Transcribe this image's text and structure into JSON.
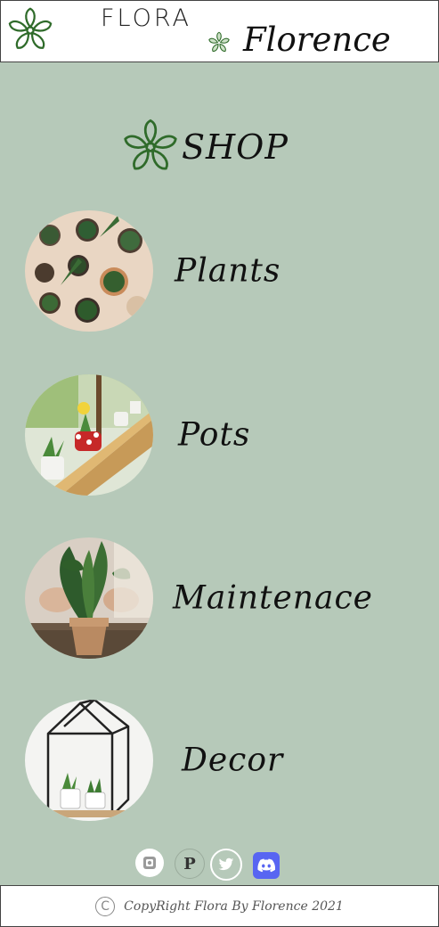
{
  "header": {
    "brand_top": "FLORA",
    "brand_main": "Florence"
  },
  "shop": {
    "title": "SHOP"
  },
  "categories": [
    {
      "label": "Plants"
    },
    {
      "label": "Pots"
    },
    {
      "label": "Maintenace"
    },
    {
      "label": "Decor"
    }
  ],
  "social": [
    {
      "icon": "instagram-icon"
    },
    {
      "icon": "pinterest-icon"
    },
    {
      "icon": "twitter-icon"
    },
    {
      "icon": "discord-icon"
    }
  ],
  "footer": {
    "copyright_symbol": "C",
    "text": "CopyRight Flora By Florence 2021"
  },
  "colors": {
    "background": "#b6c9b9",
    "header_bg": "#ffffff",
    "leaf_green": "#2f6b2a",
    "discord": "#5865f2"
  }
}
